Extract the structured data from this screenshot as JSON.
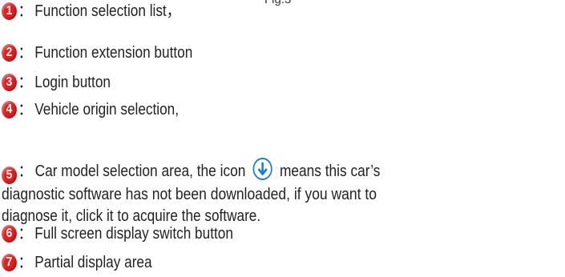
{
  "caption": "Fig.3",
  "colors": {
    "badge": "#e02020",
    "download_icon": "#1a7fd4"
  },
  "items": [
    {
      "num": "1",
      "sep": "：",
      "text": "Function selection list，"
    },
    {
      "num": "2",
      "sep": "：",
      "text": "Function extension button"
    },
    {
      "num": "3",
      "sep": "：",
      "text": "Login button"
    },
    {
      "num": "4",
      "sep": "：",
      "text": "Vehicle origin selection,"
    },
    {
      "num": "6",
      "sep": "：",
      "text": "Full screen display switch button"
    },
    {
      "num": "7",
      "sep": "：",
      "text": "Partial display area"
    }
  ],
  "paragraph": {
    "num": "5",
    "sep": "：",
    "line1_before_icon": "Car model selection area, the icon",
    "line1_after_icon": "means this car’s",
    "icon": "download-arrow-icon",
    "line2": "diagnostic software has not been downloaded, if you want to",
    "line3": "diagnose it, click it to acquire the software."
  }
}
